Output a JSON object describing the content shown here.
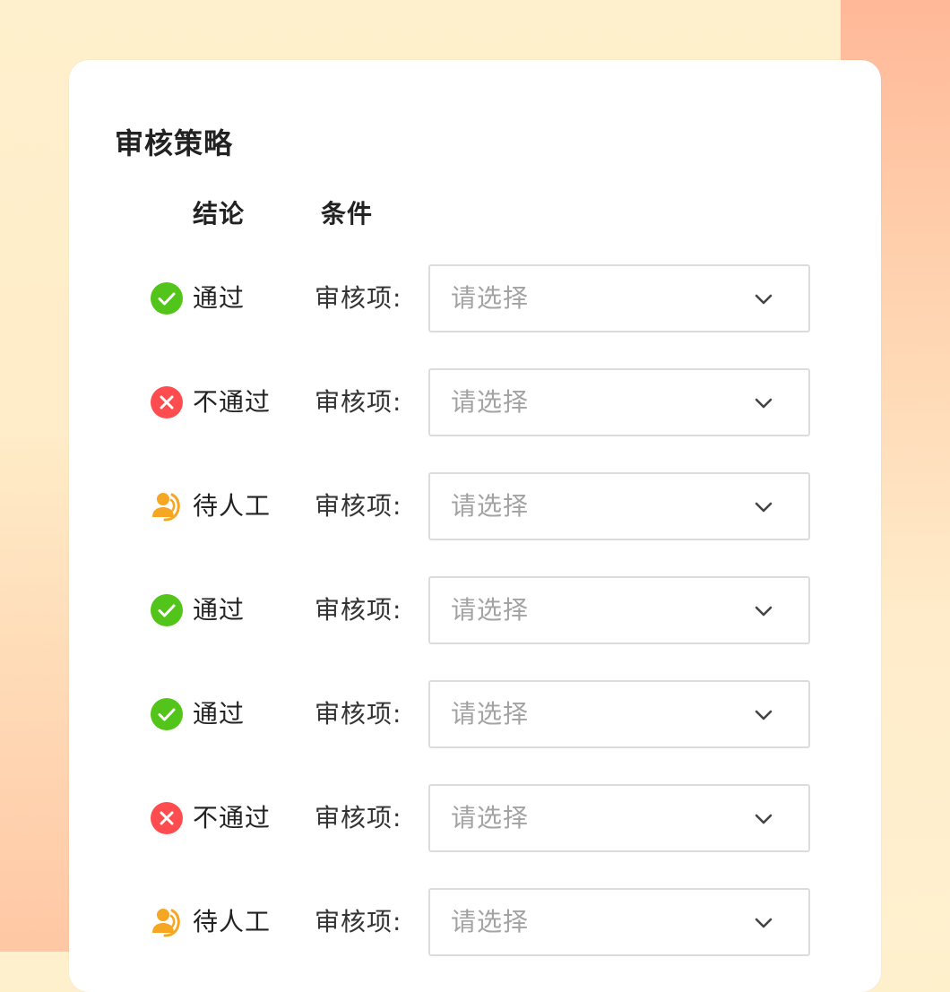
{
  "section_title": "审核策略",
  "columns": {
    "result": "结论",
    "condition": "条件"
  },
  "rows": [
    {
      "status": "pass",
      "label": "通过",
      "field_label": "审核项:",
      "placeholder": "请选择"
    },
    {
      "status": "fail",
      "label": "不通过",
      "field_label": "审核项:",
      "placeholder": "请选择"
    },
    {
      "status": "manual",
      "label": "待人工",
      "field_label": "审核项:",
      "placeholder": "请选择"
    },
    {
      "status": "pass",
      "label": "通过",
      "field_label": "审核项:",
      "placeholder": "请选择"
    },
    {
      "status": "pass",
      "label": "通过",
      "field_label": "审核项:",
      "placeholder": "请选择"
    },
    {
      "status": "fail",
      "label": "不通过",
      "field_label": "审核项:",
      "placeholder": "请选择"
    },
    {
      "status": "manual",
      "label": "待人工",
      "field_label": "审核项:",
      "placeholder": "请选择"
    }
  ],
  "icons": {
    "pass": "check-circle-icon",
    "fail": "close-circle-icon",
    "manual": "manual-review-icon",
    "dropdown": "chevron-down-icon"
  },
  "colors": {
    "pass": "#52c41a",
    "fail": "#ff4d4f",
    "manual": "#f5a623"
  }
}
